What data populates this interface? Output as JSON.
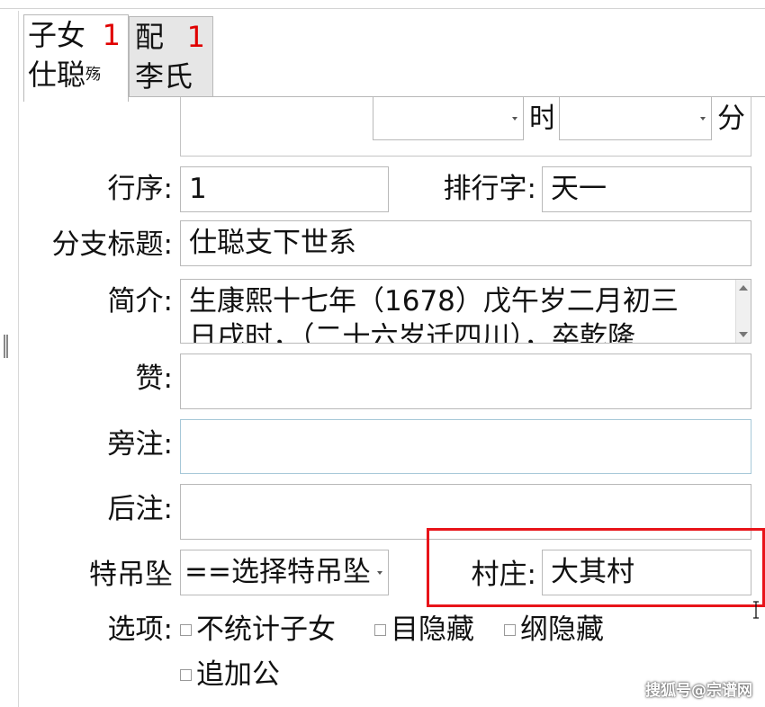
{
  "tabs": [
    {
      "line1": "子女",
      "count": "1",
      "line2": "仕聪",
      "mark": "殇"
    },
    {
      "line1": "配",
      "count": "1",
      "line2": "李氏"
    }
  ],
  "time_row": {
    "hour_suffix": "时",
    "minute_suffix": "分",
    "hour_value": "",
    "minute_value": ""
  },
  "fields": {
    "order": {
      "label": "行序:",
      "value": "1"
    },
    "rank_char": {
      "label": "排行字:",
      "value": "天一"
    },
    "branch_title": {
      "label": "分支标题:",
      "value": "仕聪支下世系"
    },
    "intro": {
      "label": "简介:",
      "line1": "生康熙十七年（1678）戊午岁二月初三",
      "line2": "日戌时，（二十六岁迁四川），卒乾隆"
    },
    "praise": {
      "label": "赞:",
      "value": ""
    },
    "side_note": {
      "label": "旁注:",
      "value": ""
    },
    "after_note": {
      "label": "后注:",
      "value": ""
    },
    "special": {
      "label": "特吊坠",
      "value": "==选择特吊坠"
    },
    "village": {
      "label": "村庄:",
      "value": "大其村"
    }
  },
  "options": {
    "label": "选项:",
    "items": [
      "不统计子女",
      "目隐藏",
      "纲隐藏",
      "追加公"
    ]
  },
  "watermark": "搜狐号@宗谱网"
}
